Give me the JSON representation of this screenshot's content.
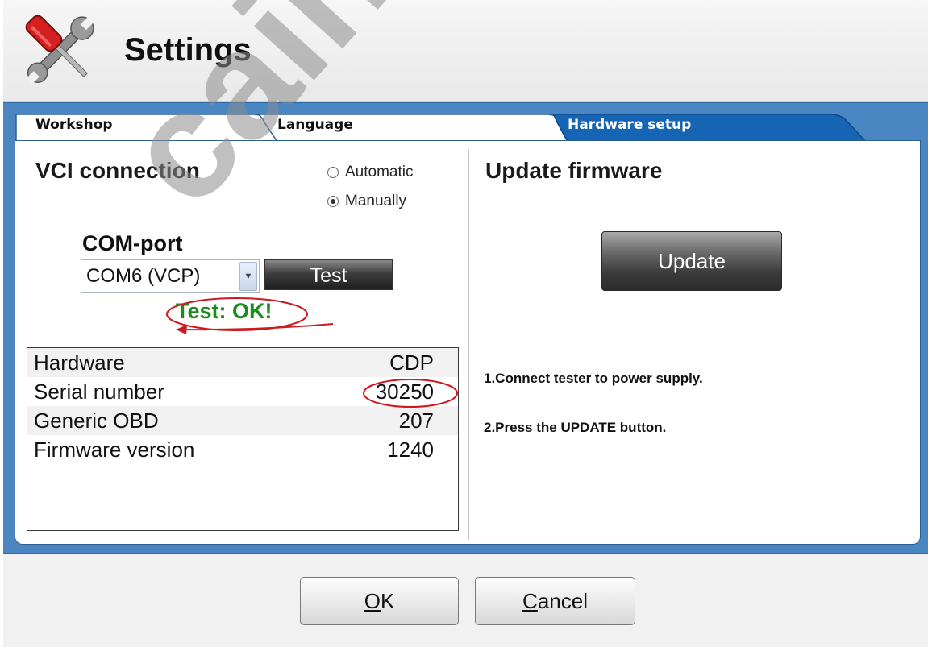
{
  "header": {
    "title": "Settings",
    "icon": "tools-icon"
  },
  "tabs": [
    {
      "label": "Workshop",
      "active": false
    },
    {
      "label": "Language",
      "active": false
    },
    {
      "label": "Hardware setup",
      "active": true
    }
  ],
  "vci": {
    "title": "VCI connection",
    "options": [
      {
        "label": "Automatic",
        "checked": false
      },
      {
        "label": "Manually",
        "checked": true
      }
    ],
    "com_port": {
      "label": "COM-port",
      "selected": "COM6 (VCP)",
      "test_label": "Test",
      "result": "Test: OK!"
    },
    "info": [
      {
        "key": "Hardware",
        "value": "CDP"
      },
      {
        "key": "Serial number",
        "value": "30250"
      },
      {
        "key": "Generic OBD",
        "value": "207"
      },
      {
        "key": "Firmware version",
        "value": "1240"
      }
    ]
  },
  "firmware": {
    "title": "Update firmware",
    "update_label": "Update",
    "instructions": [
      "1.Connect tester to power supply.",
      "2.Press the UPDATE button."
    ]
  },
  "footer": {
    "ok_mnemonic": "O",
    "ok_rest": "K",
    "cancel_mnemonic": "C",
    "cancel_rest": "ancel"
  },
  "watermark": {
    "text": "cainasit"
  },
  "colors": {
    "accent_blue": "#4a86c2",
    "active_tab": "#1565b4",
    "ok_green": "#1d8a1d",
    "annotation_red": "#d0181f"
  }
}
